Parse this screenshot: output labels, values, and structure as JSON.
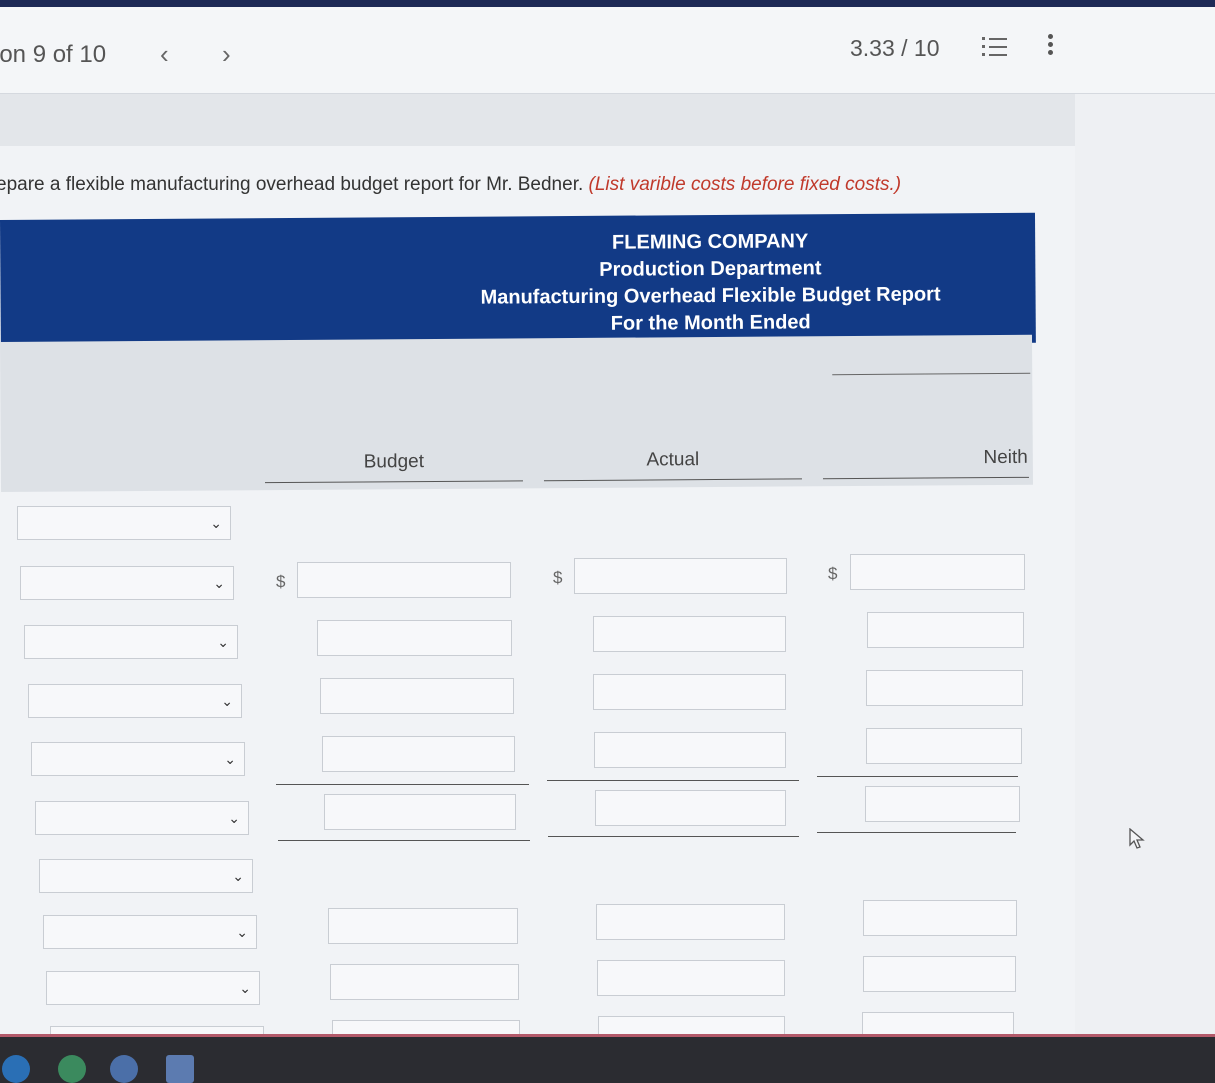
{
  "nav": {
    "question_label": "ion 9 of 10",
    "prev_glyph": "‹",
    "next_glyph": "›",
    "score": "3.33 / 10"
  },
  "instruction": {
    "text": "epare a flexible manufacturing overhead budget report for Mr. Bedner.",
    "note": "(List varible costs before fixed costs.)"
  },
  "report_header": {
    "company": "FLEMING COMPANY",
    "department": "Production Department",
    "title": "Manufacturing Overhead Flexible Budget Report",
    "period": "For the Month Ended"
  },
  "columns": {
    "budget": "Budget",
    "actual": "Actual",
    "difference": "Neith"
  },
  "currency_symbol": "$",
  "select_chevron": "⌄",
  "icons": [
    "list-icon",
    "kebab-menu-icon",
    "chevron-down-icon",
    "mouse-cursor-icon"
  ],
  "colors": {
    "header_blue": "#123a86",
    "note_red": "#c0392b",
    "taskbar": "#2b2c31"
  }
}
